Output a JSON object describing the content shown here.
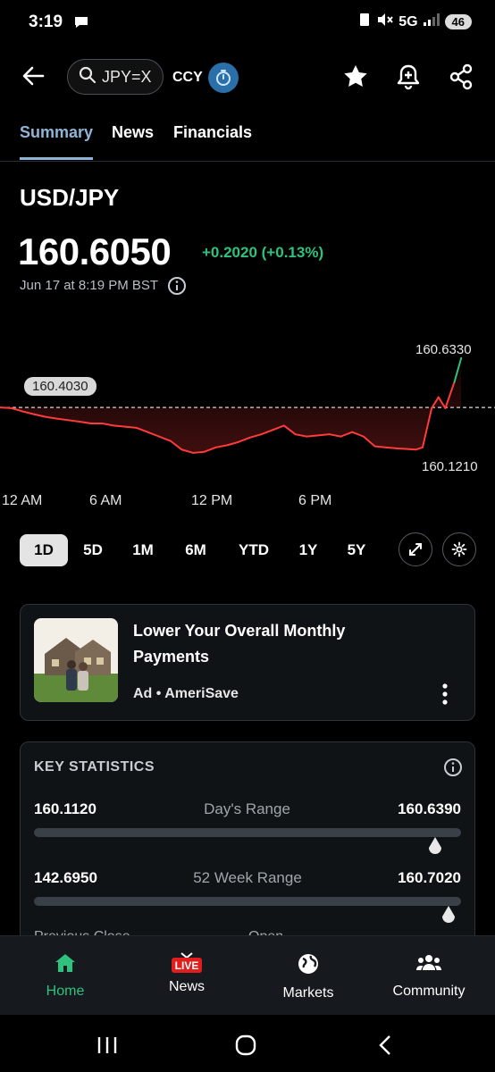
{
  "status": {
    "time": "3:19",
    "network": "5G",
    "battery": "46"
  },
  "header": {
    "search_text": "JPY=X",
    "ccy_label": "CCY"
  },
  "tabs": [
    {
      "label": "Summary"
    },
    {
      "label": "News"
    },
    {
      "label": "Financials"
    }
  ],
  "quote": {
    "ticker": "USD/JPY",
    "price": "160.6050",
    "change": "+0.2020 (+0.13%)",
    "timestamp": "Jun 17 at 8:19 PM BST"
  },
  "chart": {
    "high_label": "160.6330",
    "low_label": "160.1210",
    "prev_close_label": "160.4030",
    "x_labels": [
      "12 AM",
      "6 AM",
      "12 PM",
      "6 PM"
    ]
  },
  "chart_data": {
    "type": "line",
    "x": [
      0,
      0.5,
      1,
      1.5,
      2,
      2.5,
      3,
      3.5,
      4,
      4.5,
      5,
      5.5,
      6,
      6.5,
      7,
      7.5,
      8,
      8.5,
      9,
      9.5,
      10,
      10.5,
      11,
      11.5,
      12,
      12.5,
      13,
      13.5,
      14,
      14.5,
      15,
      15.5,
      16,
      16.5,
      17,
      17.5,
      18,
      18.3,
      18.6,
      19,
      19.3,
      19.6,
      20,
      20.3
    ],
    "values": [
      160.403,
      160.4,
      160.385,
      160.372,
      160.36,
      160.352,
      160.345,
      160.338,
      160.33,
      160.33,
      160.32,
      160.315,
      160.31,
      160.29,
      160.27,
      160.25,
      160.21,
      160.195,
      160.2,
      160.22,
      160.23,
      160.245,
      160.265,
      160.28,
      160.3,
      160.32,
      160.28,
      160.27,
      160.275,
      160.28,
      160.27,
      160.29,
      160.27,
      160.225,
      160.22,
      160.215,
      160.212,
      160.21,
      160.22,
      160.4,
      160.45,
      160.4,
      160.52,
      160.63
    ],
    "ylim": [
      160.121,
      160.633
    ],
    "xlim": [
      0,
      21
    ],
    "reference_line": 160.403
  },
  "ranges": [
    "1D",
    "5D",
    "1M",
    "6M",
    "YTD",
    "1Y",
    "5Y"
  ],
  "active_range": "1D",
  "ad": {
    "title": "Lower Your Overall Monthly Payments",
    "meta": "Ad • AmeriSave"
  },
  "stats": {
    "title": "KEY STATISTICS",
    "rows": [
      {
        "low": "160.1120",
        "label": "Day's Range",
        "high": "160.6390",
        "marker_fraction": 0.94
      },
      {
        "low": "142.6950",
        "label": "52 Week Range",
        "high": "160.7020",
        "marker_fraction": 0.97
      }
    ],
    "cut_left": "Previous Close",
    "cut_right": "Open"
  },
  "nav": [
    {
      "label": "Home",
      "color": "#2ec27e"
    },
    {
      "label": "News",
      "badge": "LIVE"
    },
    {
      "label": "Markets"
    },
    {
      "label": "Community"
    }
  ],
  "colors": {
    "up": "#2ec27e",
    "down": "#ff3b3b",
    "active_tab_underline": "#8fb4d8"
  }
}
